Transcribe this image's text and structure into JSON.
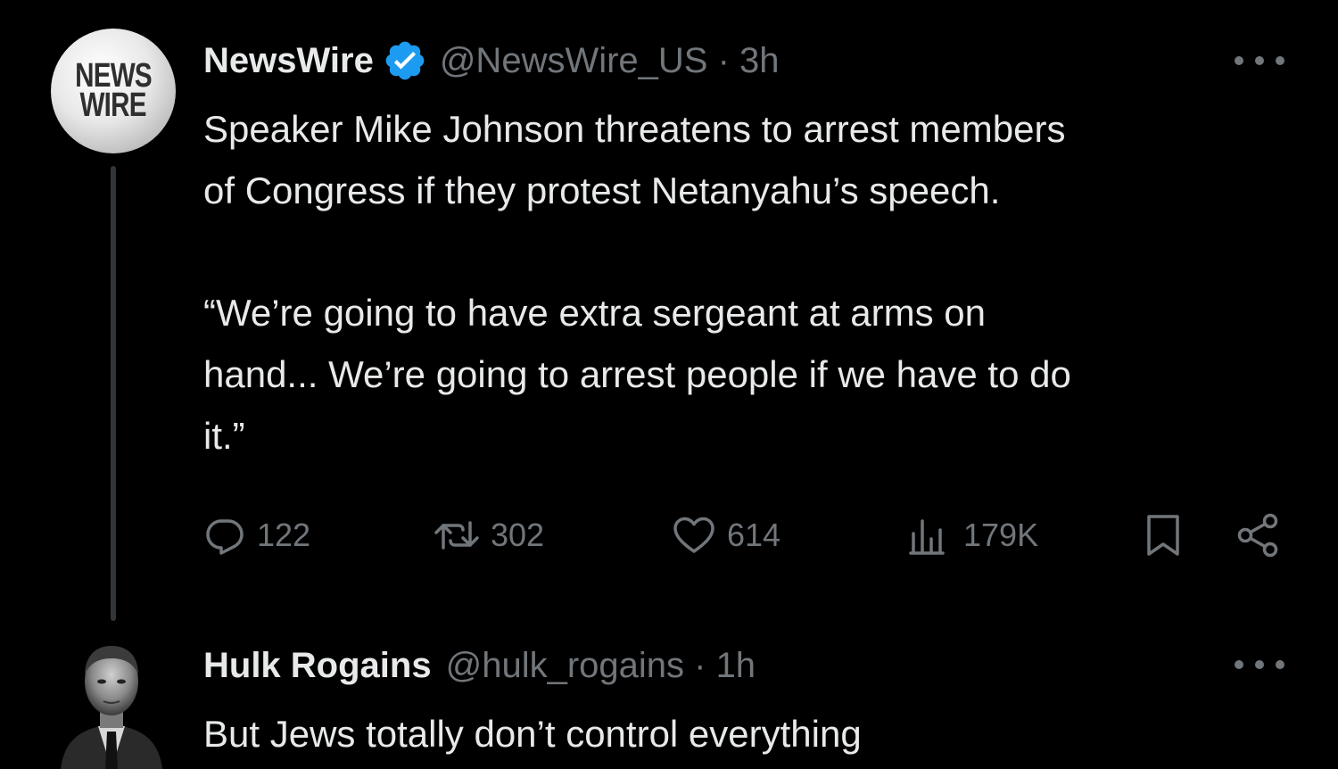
{
  "tweet": {
    "author_name": "NewsWire",
    "avatar_text": [
      "NEWS",
      "WIRE"
    ],
    "handle_time": "@NewsWire_US · 3h",
    "verified_color": "#1d9bf0",
    "paragraph1": "Speaker Mike Johnson threatens to arrest members\nof Congress if they protest Netanyahu’s speech.",
    "paragraph2": "“We’re going to have extra sergeant at arms on\nhand... We’re going to arrest people if we have to do\nit.”",
    "actions": {
      "reply": {
        "icon": "reply-icon",
        "count": "122"
      },
      "retweet": {
        "icon": "retweet-icon",
        "count": "302"
      },
      "like": {
        "icon": "heart-icon",
        "count": "614"
      },
      "views": {
        "icon": "views-icon",
        "count": "179K"
      },
      "bookmark": {
        "icon": "bookmark-icon"
      },
      "share": {
        "icon": "share-icon"
      }
    }
  },
  "reply": {
    "author_name": "Hulk Rogains",
    "handle_time": "@hulk_rogains · 1h",
    "text": "But Jews totally don’t control everything"
  },
  "colors": {
    "background": "#000000",
    "primary_text": "#e7e9ea",
    "secondary_text": "#71767b",
    "thread_line": "#333639"
  }
}
